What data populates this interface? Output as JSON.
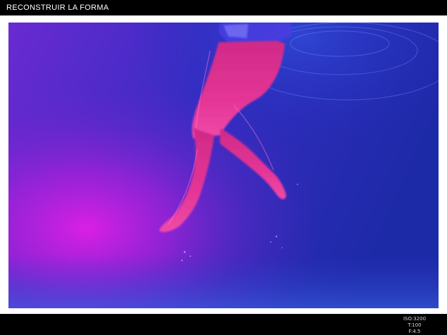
{
  "header": {
    "title": "RECONSTRUIR LA FORMA"
  },
  "photo": {
    "subject": "legs-underwater",
    "colors": {
      "deep_blue": "#1e2bb8",
      "magenta_glow": "#c21ee0",
      "violet": "#5a24c8",
      "skin": "#e0358e"
    }
  },
  "exif": {
    "iso": "ISO:3200",
    "shutter": "T:100",
    "aperture": "F:4.5"
  }
}
